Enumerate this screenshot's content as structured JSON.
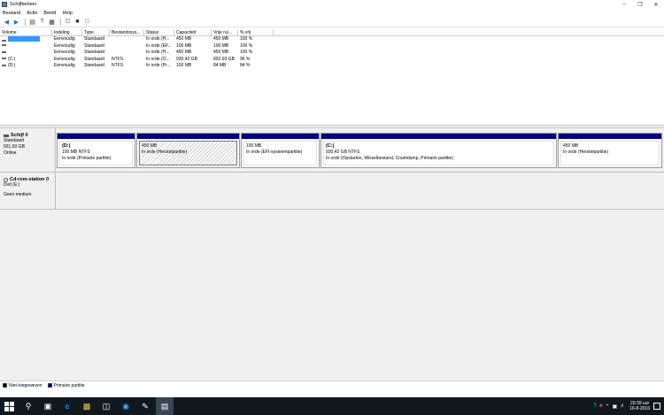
{
  "window": {
    "title": "Schijfbeheer"
  },
  "menu": [
    "Bestand",
    "Actie",
    "Beeld",
    "Help"
  ],
  "volume_list": {
    "columns": [
      "Volume",
      "Indeling",
      "Type",
      "Bestandssys...",
      "Status",
      "Capaciteit",
      "Vrije rui...",
      "% vrij"
    ],
    "rows": [
      {
        "volume": "",
        "layout": "Eenvoudig",
        "type": "Standaard",
        "fs": "",
        "status": "In orde (H...",
        "capacity": "450 MB",
        "free": "450 MB",
        "pct": "100 %"
      },
      {
        "volume": "",
        "layout": "Eenvoudig",
        "type": "Standaard",
        "fs": "",
        "status": "In orde (EF...",
        "capacity": "100 MB",
        "free": "100 MB",
        "pct": "100 %"
      },
      {
        "volume": "",
        "layout": "Eenvoudig",
        "type": "Standaard",
        "fs": "",
        "status": "In orde (H...",
        "capacity": "450 MB",
        "free": "450 MB",
        "pct": "100 %"
      },
      {
        "volume": "(C:)",
        "layout": "Eenvoudig",
        "type": "Standaard",
        "fs": "NTFS",
        "status": "In orde (O...",
        "capacity": "930,42 GB",
        "free": "892,93 GB",
        "pct": "96 %"
      },
      {
        "volume": "(D:)",
        "layout": "Eenvoudig",
        "type": "Standaard",
        "fs": "NTFS",
        "status": "In orde (Pr...",
        "capacity": "100 MB",
        "free": "84 MB",
        "pct": "84 %"
      }
    ]
  },
  "disk0": {
    "title": "Schijf 0",
    "type": "Standaard",
    "size": "931,50 GB",
    "state": "Online",
    "partitions": [
      {
        "name": "(D:)",
        "line1": "100 MB NTFS",
        "line2": "In orde (Primaire partitie)"
      },
      {
        "name": "",
        "line1": "450 MB",
        "line2": "In orde (Herstelpartitie)"
      },
      {
        "name": "",
        "line1": "100 MB",
        "line2": "In orde (EFI-systeempartitie)"
      },
      {
        "name": "(C:)",
        "line1": "930,42 GB NTFS",
        "line2": "In orde (Opstarten, Wisselbestand, Crashdump, Primaire partitie)"
      },
      {
        "name": "",
        "line1": "450 MB",
        "line2": "In orde (Herstelpartitie)"
      }
    ]
  },
  "cdrom0": {
    "title": "Cd-rom-station 0",
    "drive": "Dvd (E:)",
    "state": "Geen medium"
  },
  "legend": [
    "Niet-toegewezen",
    "Primaire partitie"
  ],
  "colors": {
    "primary_partition": "#000080",
    "unallocated": "#000000",
    "selection": "#3399ff"
  },
  "taskbar": {
    "clock_time": "20:39 uur",
    "clock_date": "16-8-2016"
  }
}
